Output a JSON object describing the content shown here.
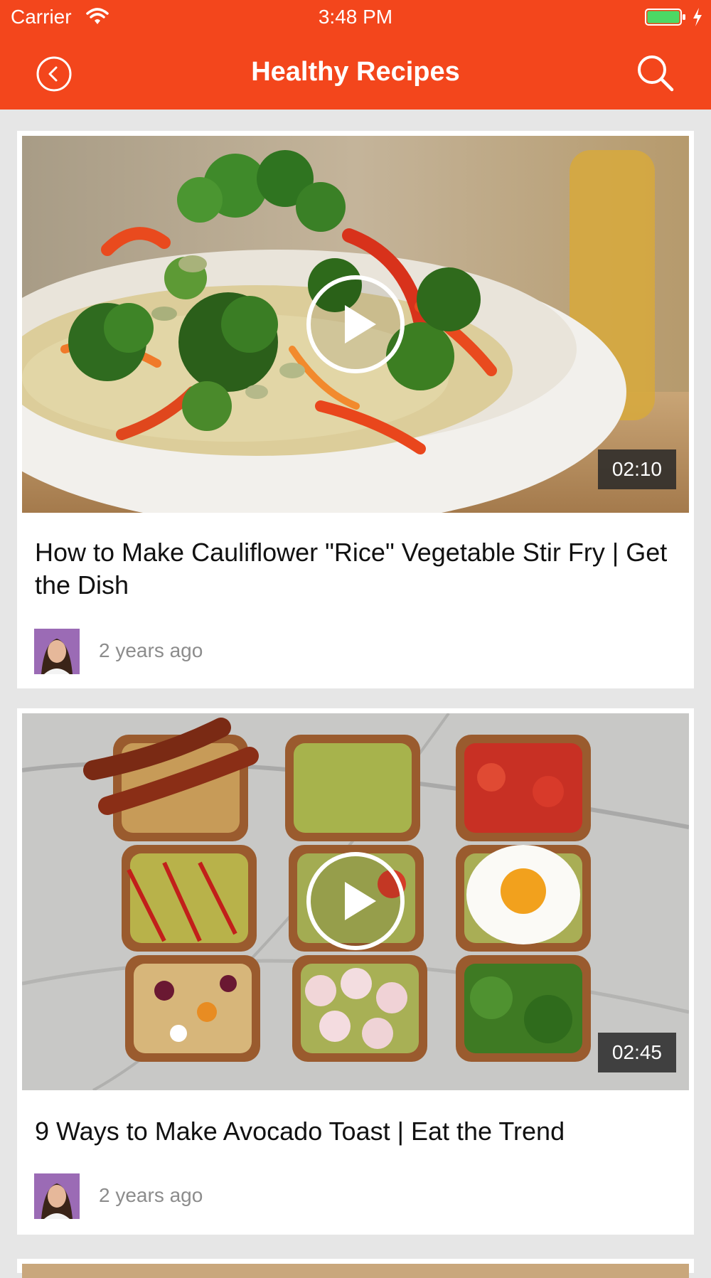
{
  "status_bar": {
    "carrier": "Carrier",
    "time": "3:48 PM",
    "battery_color": "#4cd964"
  },
  "header": {
    "title": "Healthy Recipes",
    "background": "#f3461c",
    "back_icon": "back-circle-chevron-icon",
    "search_icon": "search-icon"
  },
  "videos": [
    {
      "title": "How to Make Cauliflower \"Rice\" Vegetable Stir Fry | Get the Dish",
      "duration": "02:10",
      "posted": "2 years ago"
    },
    {
      "title": "9 Ways to Make Avocado Toast | Eat the Trend",
      "duration": "02:45",
      "posted": "2 years ago"
    }
  ]
}
